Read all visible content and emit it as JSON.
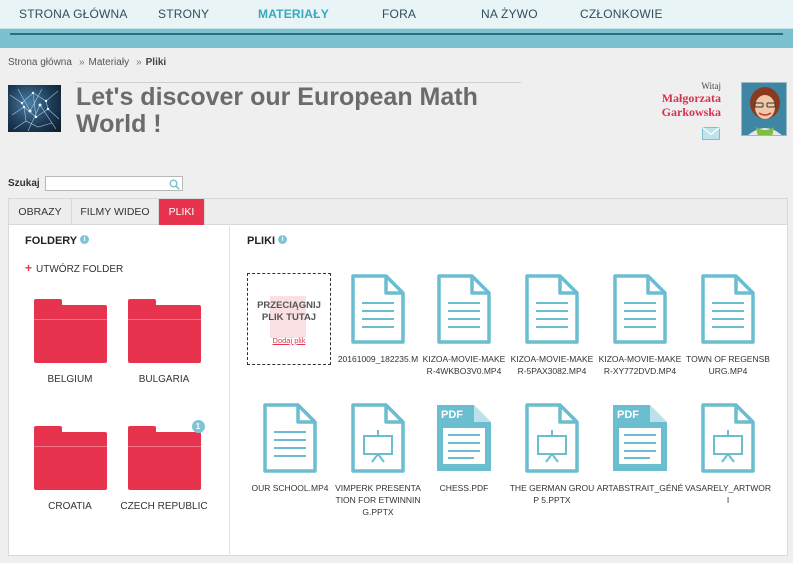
{
  "nav": {
    "items": [
      "STRONA GŁÓWNA",
      "STRONY",
      "MATERIAŁY",
      "FORA",
      "NA ŻYWO",
      "CZŁONKOWIE"
    ],
    "active": "MATERIAŁY"
  },
  "breadcrumb": [
    "Strona główna",
    "Materiały",
    "Pliki"
  ],
  "breadcrumb_sep": "»",
  "header": {
    "title": "Let's discover our European Math World !"
  },
  "user": {
    "greeting": "Witaj",
    "first_name": "Małgorzata",
    "last_name": "Garkowska"
  },
  "search": {
    "label": "Szukaj",
    "value": ""
  },
  "tabs": [
    "OBRAZY",
    "FILMY WIDEO",
    "PLIKI"
  ],
  "active_tab": "PLIKI",
  "folders": {
    "title": "FOLDERY",
    "info": "i",
    "create_label": "UTWÓRZ FOLDER",
    "create_plus": "+",
    "items": [
      {
        "name": "BELGIUM",
        "badge": ""
      },
      {
        "name": "BULGARIA",
        "badge": ""
      },
      {
        "name": "CROATIA",
        "badge": ""
      },
      {
        "name": "CZECH REPUBLIC",
        "badge": "1"
      }
    ]
  },
  "files": {
    "title": "PLIKI",
    "info": "i",
    "dropzone_text": "PRZECIĄGNIJ PLIK TUTAJ",
    "dropzone_link": "Dodaj plik",
    "pdf_label": "PDF",
    "items": [
      {
        "name": "20161009_182235.M",
        "type": "doc"
      },
      {
        "name": "KIZOA-MOVIE-MAKER-4WKBO3V0.MP4",
        "type": "doc"
      },
      {
        "name": "KIZOA-MOVIE-MAKER-5PAX3082.MP4",
        "type": "doc"
      },
      {
        "name": "KIZOA-MOVIE-MAKER-XY772DVD.MP4",
        "type": "doc"
      },
      {
        "name": "TOWN OF REGENSBURG.MP4",
        "type": "doc"
      },
      {
        "name": "OUR SCHOOL.MP4",
        "type": "doc"
      },
      {
        "name": "VIMPERK PRESENTATION FOR ETWINNING.PPTX",
        "type": "ppt"
      },
      {
        "name": "CHESS.PDF",
        "type": "pdf"
      },
      {
        "name": "THE GERMAN GROUP 5.PPTX",
        "type": "ppt"
      },
      {
        "name": "ARTABSTRAIT_GÉNÉ",
        "type": "pdf"
      },
      {
        "name": "VASARELY_ARTWORI",
        "type": "ppt"
      }
    ]
  },
  "colors": {
    "accent": "#e8334f",
    "nav_bar": "#7bc1d0",
    "nav_active": "#36a9c0",
    "file_icon": "#6bbdd0"
  }
}
